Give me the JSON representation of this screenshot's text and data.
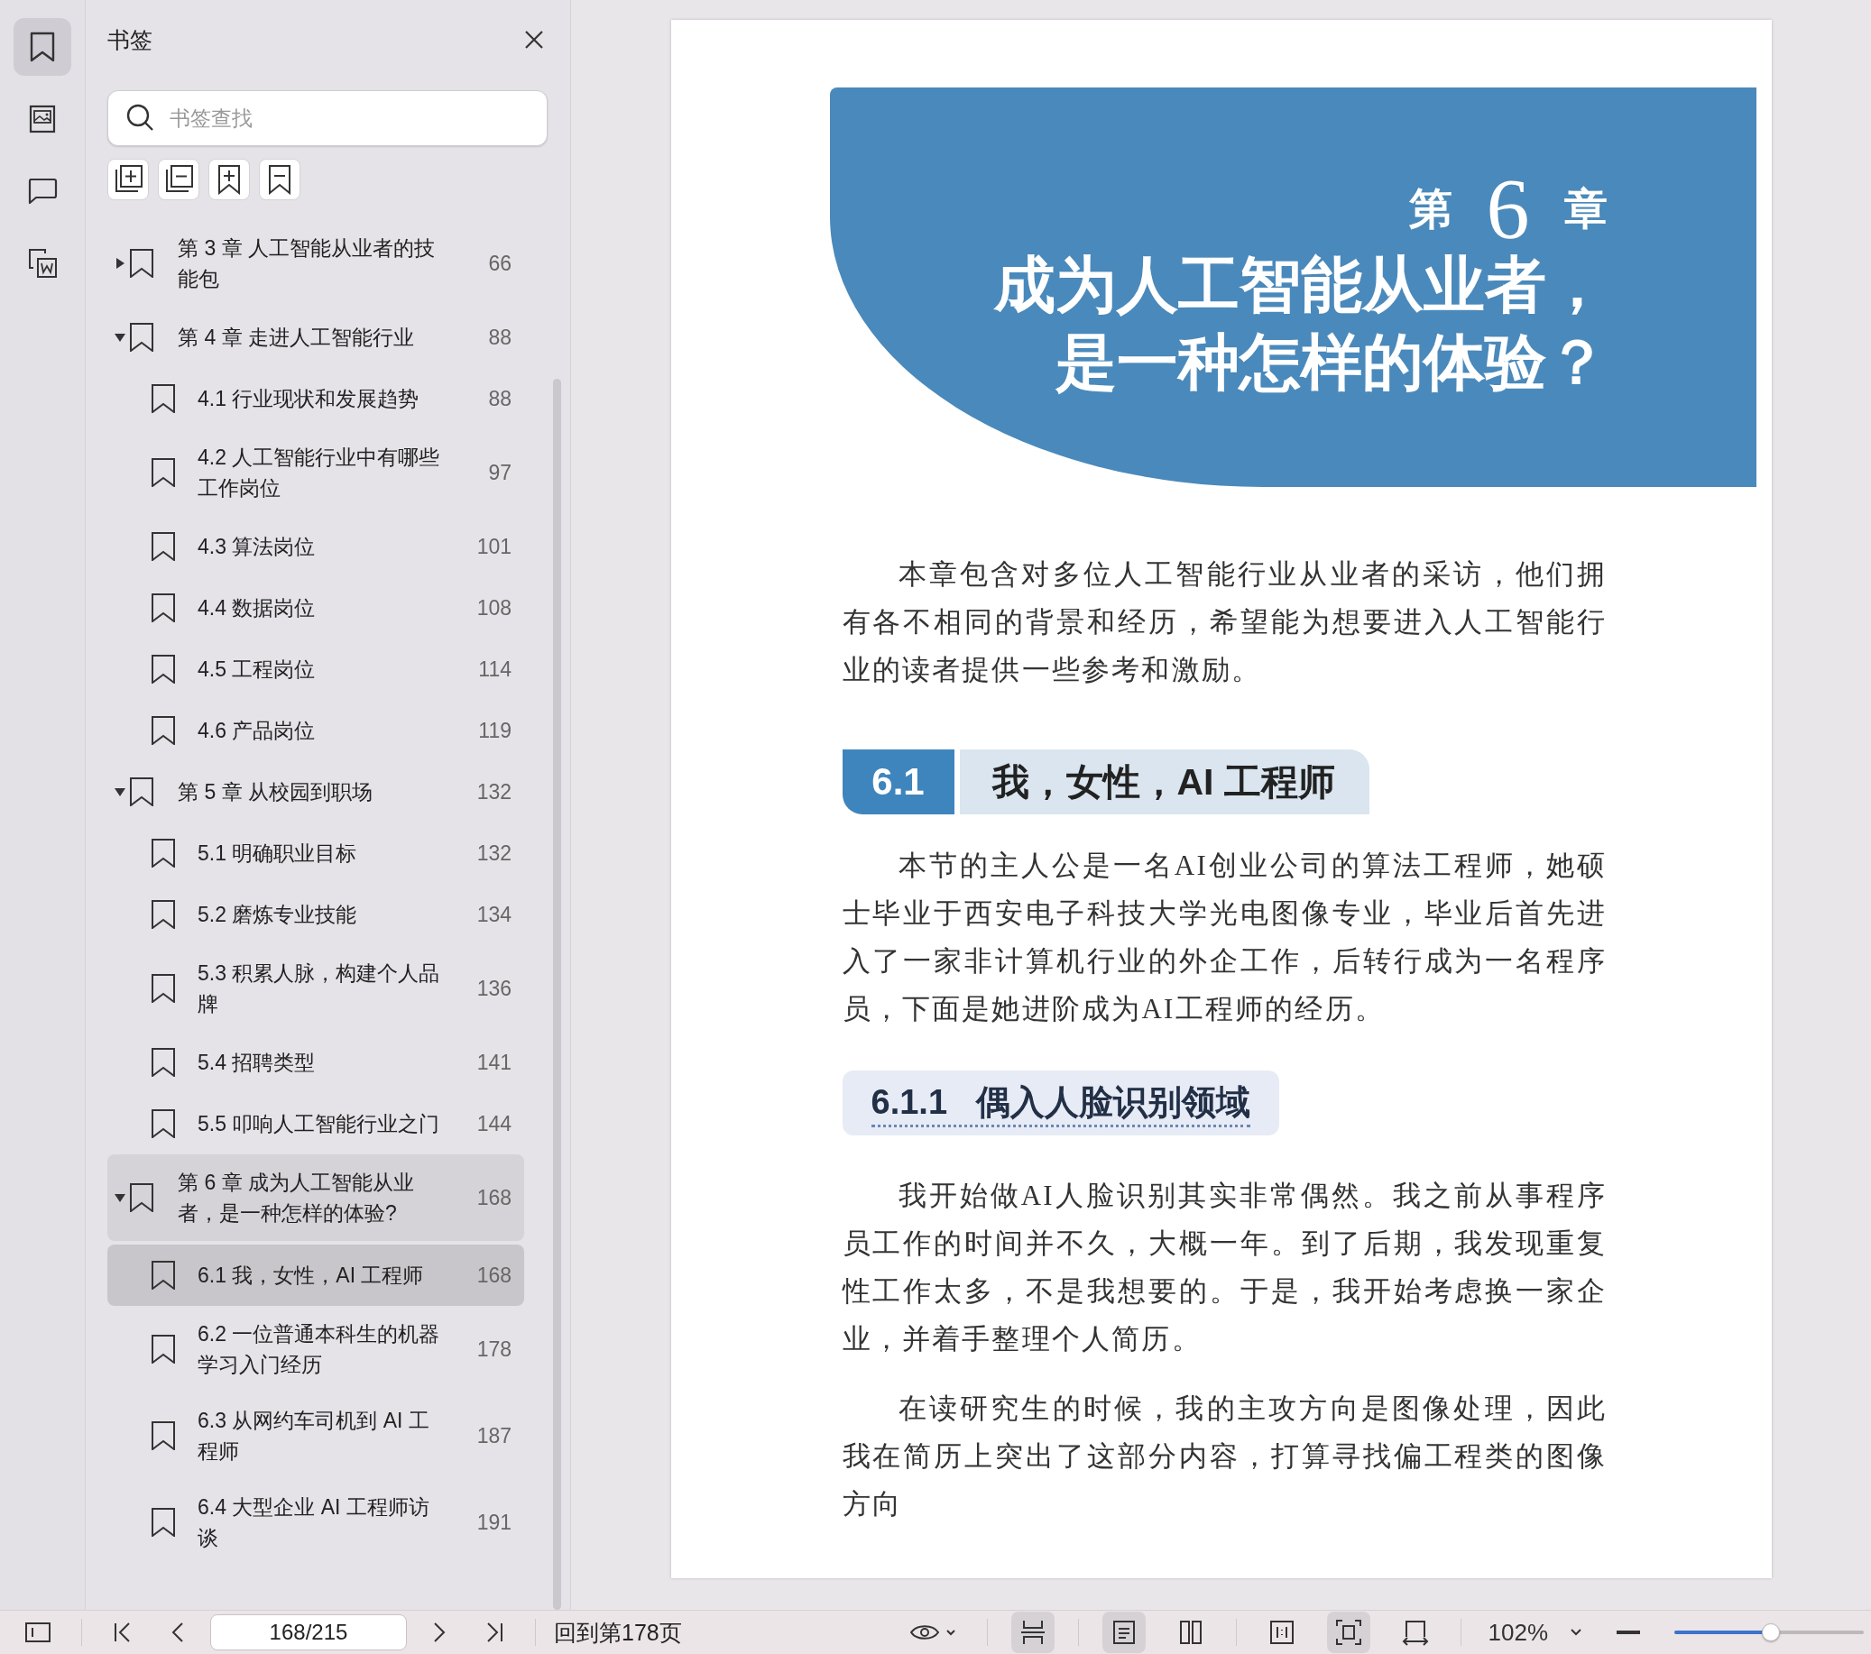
{
  "rail": [
    {
      "kind": "bookmarks",
      "selected": true
    },
    {
      "kind": "thumbnails",
      "selected": false
    },
    {
      "kind": "comments",
      "selected": false
    },
    {
      "kind": "export",
      "selected": false
    }
  ],
  "panel": {
    "title": "书签",
    "search": {
      "placeholder": "书签查找"
    },
    "tools": [
      {
        "kind": "expand-all"
      },
      {
        "kind": "collapse-all"
      },
      {
        "kind": "add"
      },
      {
        "kind": "remove"
      }
    ],
    "items": [
      {
        "label": "第 3 章 人工智能从业者的技能包",
        "page": "66",
        "expanded": false,
        "highlighted": false,
        "selected": false
      },
      {
        "label": "第 4 章 走进人工智能行业",
        "page": "88",
        "expanded": true,
        "highlighted": false,
        "selected": false,
        "children": [
          {
            "label": "4.1 行业现状和发展趋势",
            "page": "88",
            "selected": false
          },
          {
            "label": "4.2 人工智能行业中有哪些工作岗位",
            "page": "97",
            "selected": false
          },
          {
            "label": "4.3 算法岗位",
            "page": "101",
            "selected": false
          },
          {
            "label": "4.4 数据岗位",
            "page": "108",
            "selected": false
          },
          {
            "label": "4.5 工程岗位",
            "page": "114",
            "selected": false
          },
          {
            "label": "4.6 产品岗位",
            "page": "119",
            "selected": false
          }
        ]
      },
      {
        "label": "第 5 章 从校园到职场",
        "page": "132",
        "expanded": true,
        "highlighted": false,
        "selected": false,
        "children": [
          {
            "label": "5.1 明确职业目标",
            "page": "132",
            "selected": false
          },
          {
            "label": "5.2 磨炼专业技能",
            "page": "134",
            "selected": false
          },
          {
            "label": "5.3 积累人脉，构建个人品牌",
            "page": "136",
            "selected": false
          },
          {
            "label": "5.4 招聘类型",
            "page": "141",
            "selected": false
          },
          {
            "label": "5.5 叩响人工智能行业之门",
            "page": "144",
            "selected": false
          }
        ]
      },
      {
        "label": "第 6 章 成为人工智能从业者，是一种怎样的体验?",
        "page": "168",
        "expanded": true,
        "highlighted": true,
        "selected": false,
        "children": [
          {
            "label": "6.1 我，女性，AI 工程师",
            "page": "168",
            "selected": true
          },
          {
            "label": "6.2 一位普通本科生的机器学习入门经历",
            "page": "178",
            "selected": false
          },
          {
            "label": "6.3 从网约车司机到 AI 工程师",
            "page": "187",
            "selected": false
          },
          {
            "label": "6.4 大型企业 AI 工程师访谈",
            "page": "191",
            "selected": false
          }
        ]
      }
    ]
  },
  "page": {
    "chapter_prefix": "第",
    "chapter_number": "6",
    "chapter_suffix": "章",
    "title_lines": [
      "成为人工智能从业者，",
      "是一种怎样的体验？"
    ],
    "blocks": [
      {
        "kind": "paragraph",
        "text": "本章包含对多位人工智能行业从业者的采访，他们拥有各不相同的背景和经历，希望能为想要进入人工智能行业的读者提供一些参考和激励。"
      },
      {
        "kind": "section",
        "number": "6.1",
        "title": "我，女性，AI 工程师"
      },
      {
        "kind": "paragraph",
        "text": "本节的主人公是一名AI创业公司的算法工程师，她硕士毕业于西安电子科技大学光电图像专业，毕业后首先进入了一家非计算机行业的外企工作，后转行成为一名程序员，下面是她进阶成为AI工程师的经历。"
      },
      {
        "kind": "subsection",
        "number": "6.1.1",
        "title": "偶入人脸识别领域"
      },
      {
        "kind": "paragraph",
        "text": "我开始做AI人脸识别其实非常偶然。我之前从事程序员工作的时间并不久，大概一年。到了后期，我发现重复性工作太多，不是我想要的。于是，我开始考虑换一家企业，并着手整理个人简历。"
      },
      {
        "kind": "paragraph",
        "text": "在读研究生的时候，我的主攻方向是图像处理，因此我在简历上突出了这部分内容，打算寻找偏工程类的图像方向"
      }
    ]
  },
  "toolbar": {
    "page_field": "168/215",
    "goto_link": "回到第178页",
    "view_groups": [
      [
        {
          "kind": "continuous",
          "selected": true
        }
      ],
      [
        {
          "kind": "single",
          "selected": true
        },
        {
          "kind": "double",
          "selected": false
        }
      ],
      [
        {
          "kind": "fit-width",
          "selected": false
        },
        {
          "kind": "fit-page",
          "selected": true
        },
        {
          "kind": "rotate",
          "selected": false
        }
      ]
    ],
    "zoom": "102%",
    "zoom_slider": {
      "level": 0.51
    }
  }
}
